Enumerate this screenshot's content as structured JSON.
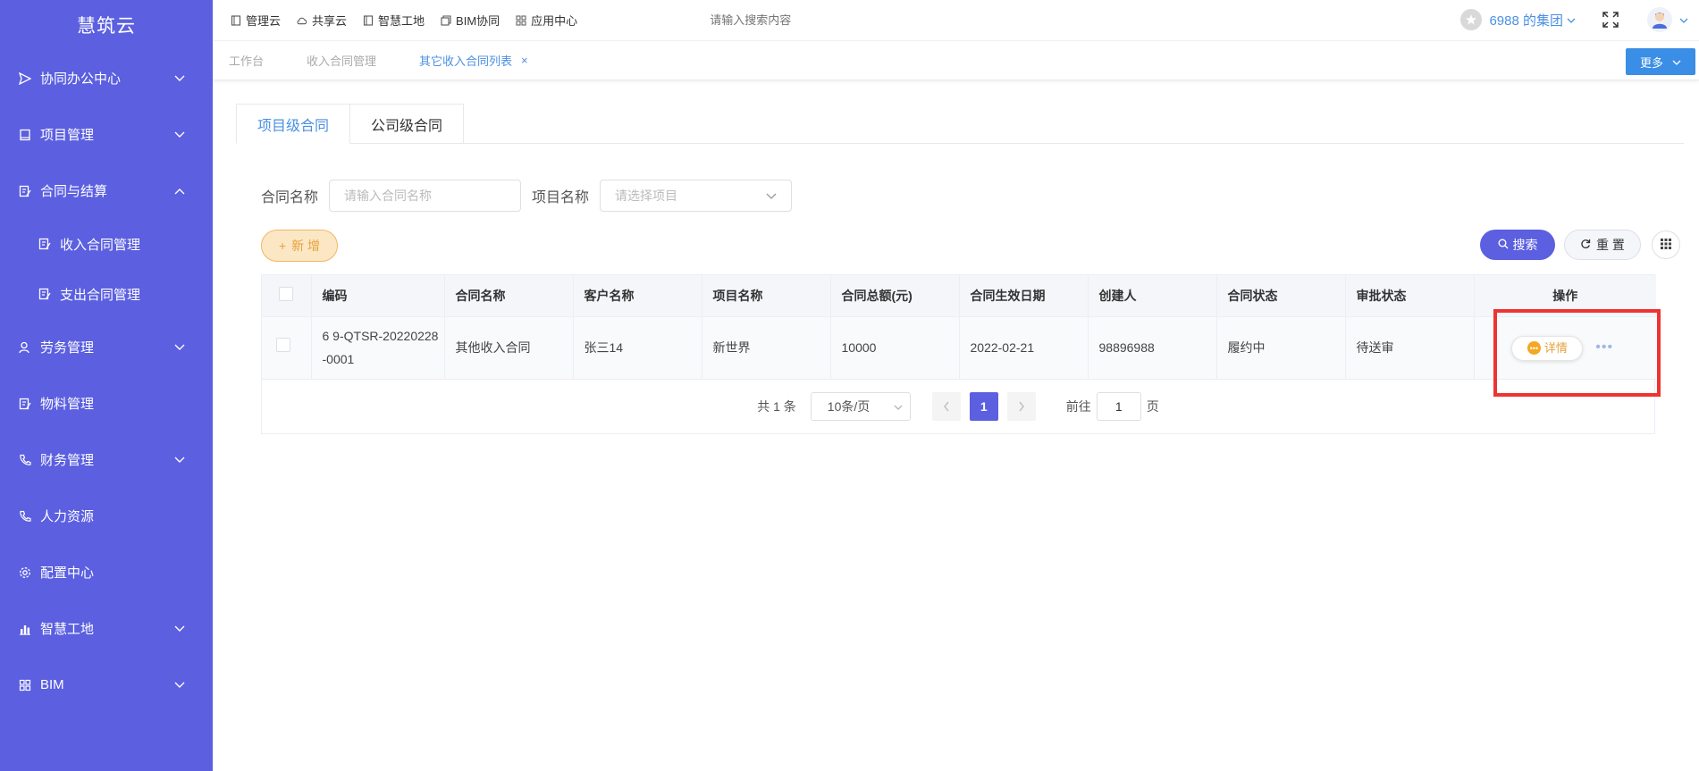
{
  "app": {
    "title": "慧筑云"
  },
  "sidebar": {
    "items": [
      {
        "label": "协同办公中心",
        "icon": "send-icon",
        "expandable": true,
        "expanded": false
      },
      {
        "label": "项目管理",
        "icon": "book-icon",
        "expandable": true,
        "expanded": false
      },
      {
        "label": "合同与结算",
        "icon": "edit-doc-icon",
        "expandable": true,
        "expanded": true
      },
      {
        "label": "收入合同管理",
        "icon": "edit-doc-icon",
        "sub": true
      },
      {
        "label": "支出合同管理",
        "icon": "edit-doc-icon",
        "sub": true
      },
      {
        "label": "劳务管理",
        "icon": "users-icon",
        "expandable": true,
        "expanded": false
      },
      {
        "label": "物料管理",
        "icon": "edit-doc-icon",
        "expandable": false
      },
      {
        "label": "财务管理",
        "icon": "phone-icon",
        "expandable": true,
        "expanded": false
      },
      {
        "label": "人力资源",
        "icon": "phone-icon",
        "expandable": false
      },
      {
        "label": "配置中心",
        "icon": "gear-icon",
        "expandable": false
      },
      {
        "label": "智慧工地",
        "icon": "bar-chart-icon",
        "expandable": true,
        "expanded": false
      },
      {
        "label": "BIM",
        "icon": "grid-icon",
        "expandable": true,
        "expanded": false
      }
    ]
  },
  "topnav": {
    "items": [
      {
        "label": "管理云",
        "icon": "doc-icon"
      },
      {
        "label": "共享云",
        "icon": "cloud-icon"
      },
      {
        "label": "智慧工地",
        "icon": "doc-icon"
      },
      {
        "label": "BIM协同",
        "icon": "layers-icon"
      },
      {
        "label": "应用中心",
        "icon": "grid-icon"
      }
    ],
    "search_placeholder": "请输入搜索内容",
    "group_name": "6988 的集团"
  },
  "tagsbar": {
    "tags": [
      {
        "label": "工作台",
        "active": false
      },
      {
        "label": "收入合同管理",
        "active": false
      },
      {
        "label": "其它收入合同列表",
        "active": true
      }
    ],
    "close_glyph": "×",
    "more_label": "更多"
  },
  "tabs": [
    {
      "label": "项目级合同",
      "active": true
    },
    {
      "label": "公司级合同",
      "active": false
    }
  ],
  "filters": {
    "contract_name_label": "合同名称",
    "contract_name_placeholder": "请输入合同名称",
    "project_name_label": "项目名称",
    "project_name_placeholder": "请选择项目"
  },
  "actions": {
    "add_label": "新 增",
    "search_label": "搜索",
    "reset_label": "重 置"
  },
  "table": {
    "columns": [
      "编码",
      "合同名称",
      "客户名称",
      "项目名称",
      "合同总额(元)",
      "合同生效日期",
      "创建人",
      "合同状态",
      "审批状态",
      "操作"
    ],
    "rows": [
      {
        "code": "6 9-QTSR-20220228-0001",
        "contract_name": "其他收入合同",
        "customer": "张三14",
        "project": "新世界",
        "amount": "10000",
        "effective_date": "2022-02-21",
        "creator": "98896988",
        "contract_status": "履约中",
        "approval_status": "待送审",
        "detail_label": "详情",
        "more_glyph": "•••"
      }
    ]
  },
  "pagination": {
    "total_text": "共 1 条",
    "page_size": "10条/页",
    "current_page": "1",
    "goto_label": "前往",
    "goto_value": "1",
    "page_unit": "页"
  },
  "colors": {
    "sidebar_bg": "#5b5fe0",
    "primary": "#5b5fe0",
    "link_blue": "#4a90e2",
    "warning_orange": "#e6a23c",
    "highlight_red": "#ee3333"
  }
}
